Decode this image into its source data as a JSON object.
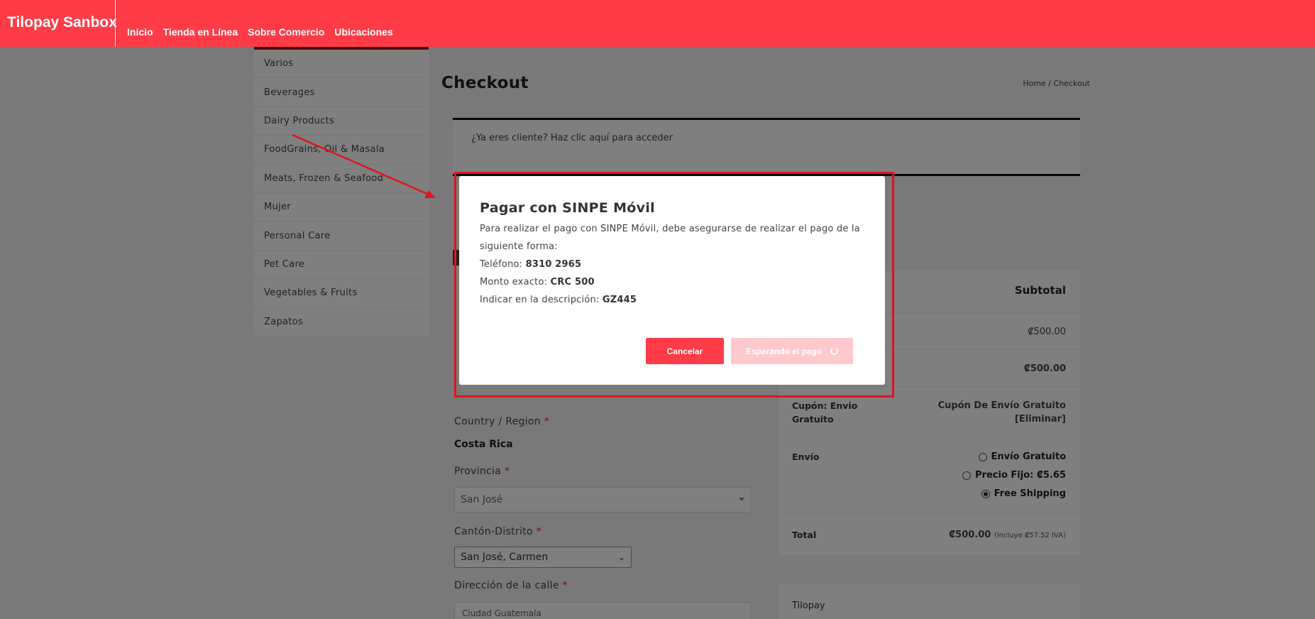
{
  "header": {
    "brand": "Tilopay Sanbox",
    "nav": [
      "Inicio",
      "Tienda en Línea",
      "Sobre Comercio",
      "Ubicaciones"
    ]
  },
  "sidebar": {
    "categories": [
      "Varios",
      "Beverages",
      "Dairy Products",
      "FoodGrains, Oil & Masala",
      "Meats, Frozen & Seafood",
      "Mujer",
      "Personal Care",
      "Pet Care",
      "Vegetables & Fruits",
      "Zapatos"
    ]
  },
  "page": {
    "title": "Checkout",
    "breadcrumb": "Home /  Checkout",
    "returning_customer": "¿Ya eres cliente? Haz clic aquí para acceder"
  },
  "billing": {
    "country_label": "Country / Region",
    "country_value": "Costa Rica",
    "provincia_label": "Provincia",
    "provincia_value": "San José",
    "canton_label": "Cantón-Distrito",
    "canton_value": "San José, Carmen",
    "street_label": "Dirección de la calle",
    "street_value": "Ciudad Guatemala",
    "required_mark": "*"
  },
  "order": {
    "subtotal_header": "Subtotal",
    "item_subtotal": "₡500.00",
    "cart_subtotal": "₡500.00",
    "coupon_label": "Cupón: Envio Gratuito",
    "coupon_value": "Cupón De Envío Gratuito",
    "coupon_remove": "[Eliminar]",
    "shipping_label": "Envío",
    "shipping_options": [
      {
        "label": "Envío Gratuito",
        "price": "",
        "checked": false
      },
      {
        "label": "Precio Fijo: ",
        "price": "₡5.65",
        "checked": false
      },
      {
        "label": "Free Shipping",
        "price": "",
        "checked": true
      }
    ],
    "total_label": "Total",
    "total_value": "₡500.00",
    "total_tax_note": "(Incluye ₡57.52 IVA)",
    "payment_method": "Tilopay"
  },
  "modal": {
    "title": "Pagar con SINPE Móvil",
    "intro": "Para realizar el pago con SINPE Móvil, debe asegurarse de realizar el pago de la siguiente forma:",
    "phone_label": "Teléfono: ",
    "phone_value": "8310 2965",
    "amount_label": "Monto exacto: ",
    "amount_value": "CRC 500",
    "desc_label": "Indicar en la descripción: ",
    "desc_value": "GZ445",
    "cancel_button": "Cancelar",
    "waiting_button": "Esperando el pago"
  },
  "colors": {
    "brand_red": "#ff3b47",
    "annotation_red": "#e0141e",
    "waiting_button_bg": "#ffc9cd"
  }
}
